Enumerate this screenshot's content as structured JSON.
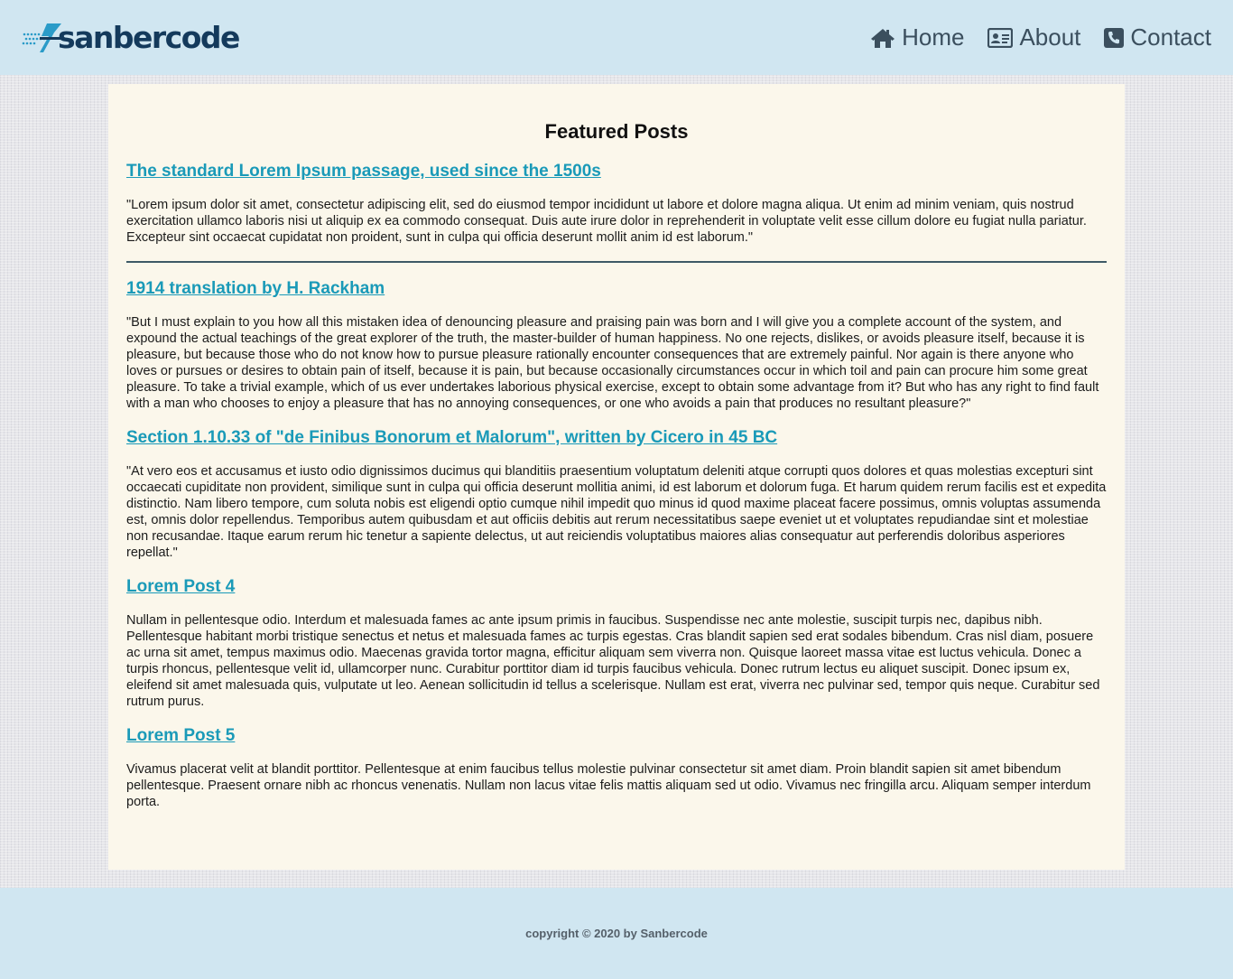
{
  "header": {
    "logo_text": "sanbercode",
    "nav": [
      {
        "label": "Home",
        "icon": "home-icon"
      },
      {
        "label": "About",
        "icon": "id-card-icon"
      },
      {
        "label": "Contact",
        "icon": "phone-icon"
      }
    ]
  },
  "main": {
    "title": "Featured Posts",
    "posts": [
      {
        "title": "The standard Lorem Ipsum passage, used since the 1500s",
        "body": "\"Lorem ipsum dolor sit amet, consectetur adipiscing elit, sed do eiusmod tempor incididunt ut labore et dolore magna aliqua. Ut enim ad minim veniam, quis nostrud exercitation ullamco laboris nisi ut aliquip ex ea commodo consequat. Duis aute irure dolor in reprehenderit in voluptate velit esse cillum dolore eu fugiat nulla pariatur. Excepteur sint occaecat cupidatat non proident, sunt in culpa qui officia deserunt mollit anim id est laborum.\""
      },
      {
        "title": "1914 translation by H. Rackham",
        "body": "\"But I must explain to you how all this mistaken idea of denouncing pleasure and praising pain was born and I will give you a complete account of the system, and expound the actual teachings of the great explorer of the truth, the master-builder of human happiness. No one rejects, dislikes, or avoids pleasure itself, because it is pleasure, but because those who do not know how to pursue pleasure rationally encounter consequences that are extremely painful. Nor again is there anyone who loves or pursues or desires to obtain pain of itself, because it is pain, but because occasionally circumstances occur in which toil and pain can procure him some great pleasure. To take a trivial example, which of us ever undertakes laborious physical exercise, except to obtain some advantage from it? But who has any right to find fault with a man who chooses to enjoy a pleasure that has no annoying consequences, or one who avoids a pain that produces no resultant pleasure?\""
      },
      {
        "title": "Section 1.10.33 of \"de Finibus Bonorum et Malorum\", written by Cicero in 45 BC",
        "body": "\"At vero eos et accusamus et iusto odio dignissimos ducimus qui blanditiis praesentium voluptatum deleniti atque corrupti quos dolores et quas molestias excepturi sint occaecati cupiditate non provident, similique sunt in culpa qui officia deserunt mollitia animi, id est laborum et dolorum fuga. Et harum quidem rerum facilis est et expedita distinctio. Nam libero tempore, cum soluta nobis est eligendi optio cumque nihil impedit quo minus id quod maxime placeat facere possimus, omnis voluptas assumenda est, omnis dolor repellendus. Temporibus autem quibusdam et aut officiis debitis aut rerum necessitatibus saepe eveniet ut et voluptates repudiandae sint et molestiae non recusandae. Itaque earum rerum hic tenetur a sapiente delectus, ut aut reiciendis voluptatibus maiores alias consequatur aut perferendis doloribus asperiores repellat.\""
      },
      {
        "title": "Lorem Post 4",
        "body": "Nullam in pellentesque odio. Interdum et malesuada fames ac ante ipsum primis in faucibus. Suspendisse nec ante molestie, suscipit turpis nec, dapibus nibh. Pellentesque habitant morbi tristique senectus et netus et malesuada fames ac turpis egestas. Cras blandit sapien sed erat sodales bibendum. Cras nisl diam, posuere ac urna sit amet, tempus maximus odio. Maecenas gravida tortor magna, efficitur aliquam sem viverra non. Quisque laoreet massa vitae est luctus vehicula. Donec a turpis rhoncus, pellentesque velit id, ullamcorper nunc. Curabitur porttitor diam id turpis faucibus vehicula. Donec rutrum lectus eu aliquet suscipit. Donec ipsum ex, eleifend sit amet malesuada quis, vulputate ut leo. Aenean sollicitudin id tellus a scelerisque. Nullam est erat, viverra nec pulvinar sed, tempor quis neque. Curabitur sed rutrum purus."
      },
      {
        "title": "Lorem Post 5",
        "body": "Vivamus placerat velit at blandit porttitor. Pellentesque at enim faucibus tellus molestie pulvinar consectetur sit amet diam. Proin blandit sapien sit amet bibendum pellentesque. Praesent ornare nibh ac rhoncus venenatis. Nullam non lacus vitae felis mattis aliquam sed ut odio. Vivamus nec fringilla arcu. Aliquam semper interdum porta."
      }
    ]
  },
  "footer": {
    "copyright": "copyright © 2020 by Sanbercode"
  },
  "colors": {
    "header_bg": "#d0e6f1",
    "content_bg": "#fbf7eb",
    "link": "#1a9ab8",
    "logo": "#143a5c",
    "nav_text": "#3b4f5e"
  }
}
